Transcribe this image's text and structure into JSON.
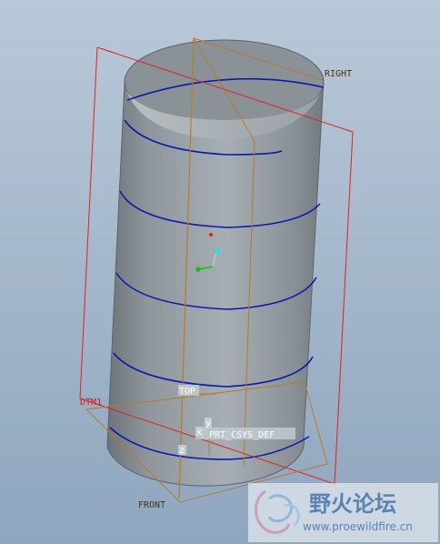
{
  "colors": {
    "background_top": "#b9c8d8",
    "background_bottom": "#8ea6bf",
    "surface": "#8e969c",
    "helix": "#0a1aa8",
    "datum_plane_orange": "#b87a2a",
    "datum_plane_red": "#e02020",
    "label_red": "#d8141a",
    "axis_y_cyan": "#22e0e0",
    "axis_x_green": "#18c018",
    "watermark_text": "#5a83b4"
  },
  "datum_labels": {
    "right": "RIGHT",
    "top": "TOP",
    "front": "FRONT",
    "dtm": "DTM1",
    "csys": "PRT_CSYS_DEF"
  },
  "axis_tags": {
    "x": "x",
    "y": "y",
    "z": "z"
  },
  "watermark": {
    "title": "野火论坛",
    "url": "www.proewildfire.cn"
  }
}
